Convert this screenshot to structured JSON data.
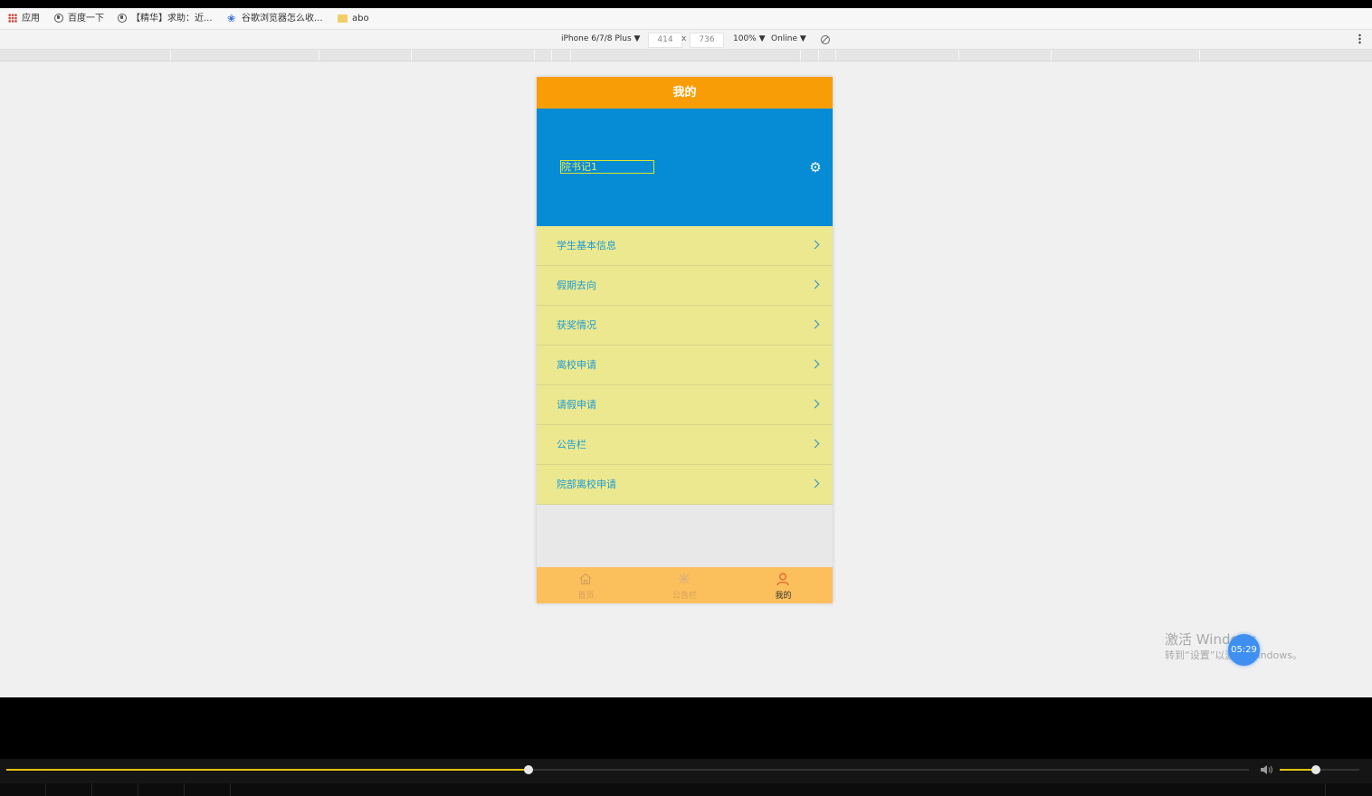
{
  "bookmarks": [
    {
      "label": "应用",
      "icon": "apps-grid-icon"
    },
    {
      "label": "百度一下",
      "icon": "globe-icon"
    },
    {
      "label": "【精华】求助：近...",
      "icon": "globe-icon"
    },
    {
      "label": "谷歌浏览器怎么收...",
      "icon": "paw-icon"
    },
    {
      "label": "abo",
      "icon": "folder-icon"
    }
  ],
  "devtools": {
    "device": "iPhone 6/7/8 Plus ▼",
    "width": "414",
    "times": "x",
    "height": "736",
    "zoom": "100% ▼",
    "network": "Online ▼"
  },
  "app": {
    "header_title": "我的",
    "username": "院书记1",
    "menu": [
      {
        "label": "学生基本信息"
      },
      {
        "label": "假期去向"
      },
      {
        "label": "获奖情况"
      },
      {
        "label": "离校申请"
      },
      {
        "label": "请假申请"
      },
      {
        "label": "公告栏"
      },
      {
        "label": "院部离校申请"
      }
    ],
    "tabs": [
      {
        "label": "首页",
        "icon": "home-icon"
      },
      {
        "label": "公告栏",
        "icon": "notice-icon"
      },
      {
        "label": "我的",
        "icon": "user-icon"
      }
    ],
    "active_tab": 2,
    "colors": {
      "header": "#f99d07",
      "profile": "#068cd4",
      "menu_bg": "#ebe88f",
      "menu_text": "#1f9bd6",
      "tabbar": "#fbbf5c"
    }
  },
  "watermark": {
    "line1": "激活 Windows",
    "line2": "转到“设置”以激活 Windows。"
  },
  "player": {
    "timer": "05:29",
    "progress": 0.42,
    "volume": 0.45,
    "accent": "#e5c20f"
  }
}
